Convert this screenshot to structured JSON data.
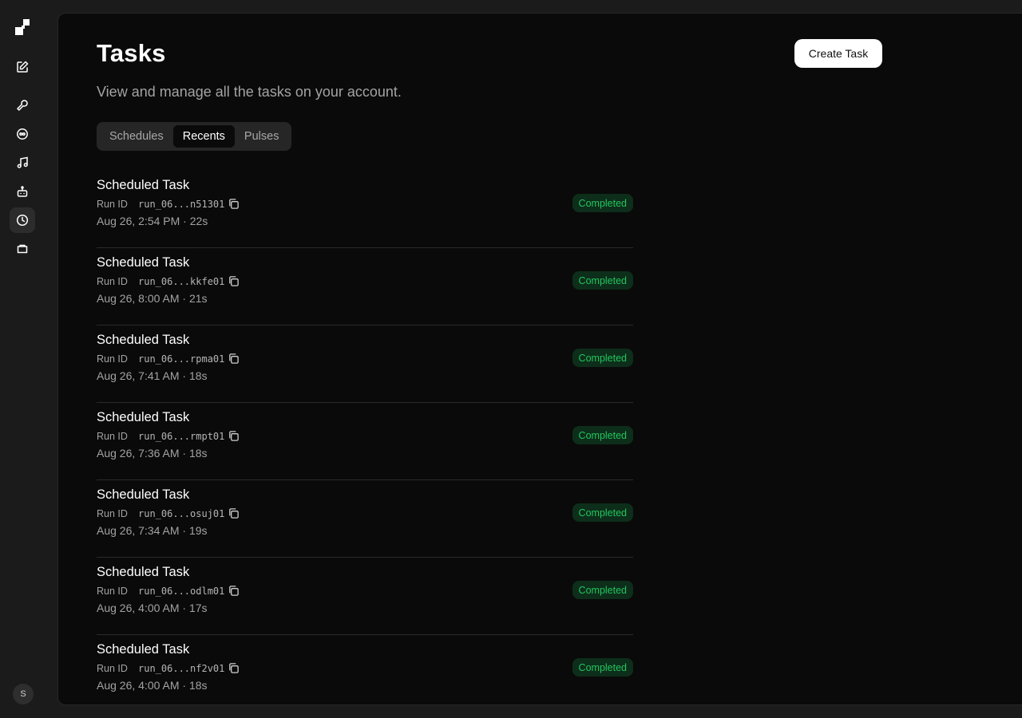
{
  "sidebar": {
    "avatar_initial": "S",
    "items": [
      {
        "icon": "pencil-square-icon"
      },
      {
        "icon": "wrench-icon"
      },
      {
        "icon": "agent-circle-icon"
      },
      {
        "icon": "music-note-icon"
      },
      {
        "icon": "robot-icon"
      },
      {
        "icon": "clock-icon"
      },
      {
        "icon": "folder-icon"
      }
    ]
  },
  "header": {
    "title": "Tasks",
    "subtitle": "View and manage all the tasks on your account.",
    "create_label": "Create Task"
  },
  "tabs": [
    {
      "label": "Schedules",
      "active": false
    },
    {
      "label": "Recents",
      "active": true
    },
    {
      "label": "Pulses",
      "active": false
    }
  ],
  "run_id_label": "Run ID",
  "tasks": [
    {
      "title": "Scheduled Task",
      "run_id": "run_06...n51301",
      "meta": "Aug 26, 2:54 PM · 22s",
      "status": "Completed"
    },
    {
      "title": "Scheduled Task",
      "run_id": "run_06...kkfe01",
      "meta": "Aug 26, 8:00 AM · 21s",
      "status": "Completed"
    },
    {
      "title": "Scheduled Task",
      "run_id": "run_06...rpma01",
      "meta": "Aug 26, 7:41 AM · 18s",
      "status": "Completed"
    },
    {
      "title": "Scheduled Task",
      "run_id": "run_06...rmpt01",
      "meta": "Aug 26, 7:36 AM · 18s",
      "status": "Completed"
    },
    {
      "title": "Scheduled Task",
      "run_id": "run_06...osuj01",
      "meta": "Aug 26, 7:34 AM · 19s",
      "status": "Completed"
    },
    {
      "title": "Scheduled Task",
      "run_id": "run_06...odlm01",
      "meta": "Aug 26, 4:00 AM · 17s",
      "status": "Completed"
    },
    {
      "title": "Scheduled Task",
      "run_id": "run_06...nf2v01",
      "meta": "Aug 26, 4:00 AM · 18s",
      "status": "Completed"
    }
  ],
  "colors": {
    "status_text": "#22c55e",
    "status_bg": "#0d2e1a",
    "panel_bg": "#0a0a0a"
  }
}
